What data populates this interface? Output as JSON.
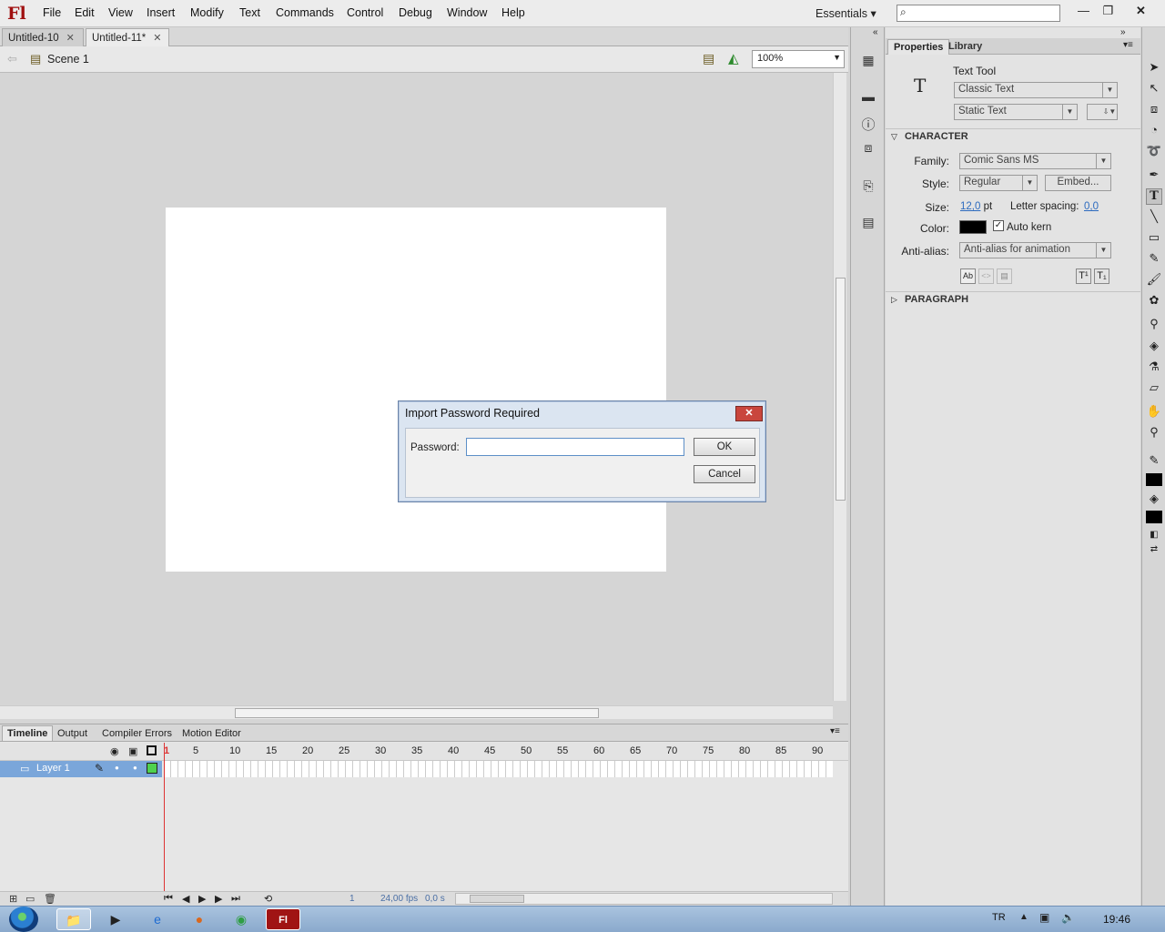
{
  "app": {
    "logo": "Fl"
  },
  "menu": [
    "File",
    "Edit",
    "View",
    "Insert",
    "Modify",
    "Text",
    "Commands",
    "Control",
    "Debug",
    "Window",
    "Help"
  ],
  "workspace": "Essentials",
  "window_controls": {
    "minimize": "—",
    "restore": "❐",
    "close": "✕"
  },
  "tabs": [
    {
      "label": "Untitled-10",
      "active": false
    },
    {
      "label": "Untitled-11*",
      "active": true
    }
  ],
  "scene": {
    "label": "Scene 1",
    "zoom": "100%"
  },
  "dialog": {
    "title": "Import Password Required",
    "password_label": "Password:",
    "password_value": "",
    "ok_label": "OK",
    "cancel_label": "Cancel"
  },
  "timeline": {
    "tabs": [
      "Timeline",
      "Output",
      "Compiler Errors",
      "Motion Editor"
    ],
    "frame_numbers": [
      "1",
      "5",
      "10",
      "15",
      "20",
      "25",
      "30",
      "35",
      "40",
      "45",
      "50",
      "55",
      "60",
      "65",
      "70",
      "75",
      "80",
      "85",
      "90"
    ],
    "layer_name": "Layer 1",
    "current_frame": "1",
    "fps": "24,00",
    "fps_unit": "fps",
    "time": "0,0",
    "time_unit": "s"
  },
  "properties": {
    "tabs": [
      "Properties",
      "Library"
    ],
    "tool_name": "Text Tool",
    "text_engine": "Classic Text",
    "text_type": "Static Text",
    "character_header": "CHARACTER",
    "family_label": "Family:",
    "family_value": "Comic Sans MS",
    "style_label": "Style:",
    "style_value": "Regular",
    "embed_label": "Embed...",
    "size_label": "Size:",
    "size_value": "12,0",
    "size_unit": "pt",
    "letter_spacing_label": "Letter spacing:",
    "letter_spacing_value": "0,0",
    "color_label": "Color:",
    "color_value": "#000000",
    "autokern_label": "Auto kern",
    "antialias_label": "Anti-alias:",
    "antialias_value": "Anti-alias for animation",
    "paragraph_header": "PARAGRAPH"
  },
  "taskbar": {
    "lang": "TR",
    "time": "19:46"
  }
}
